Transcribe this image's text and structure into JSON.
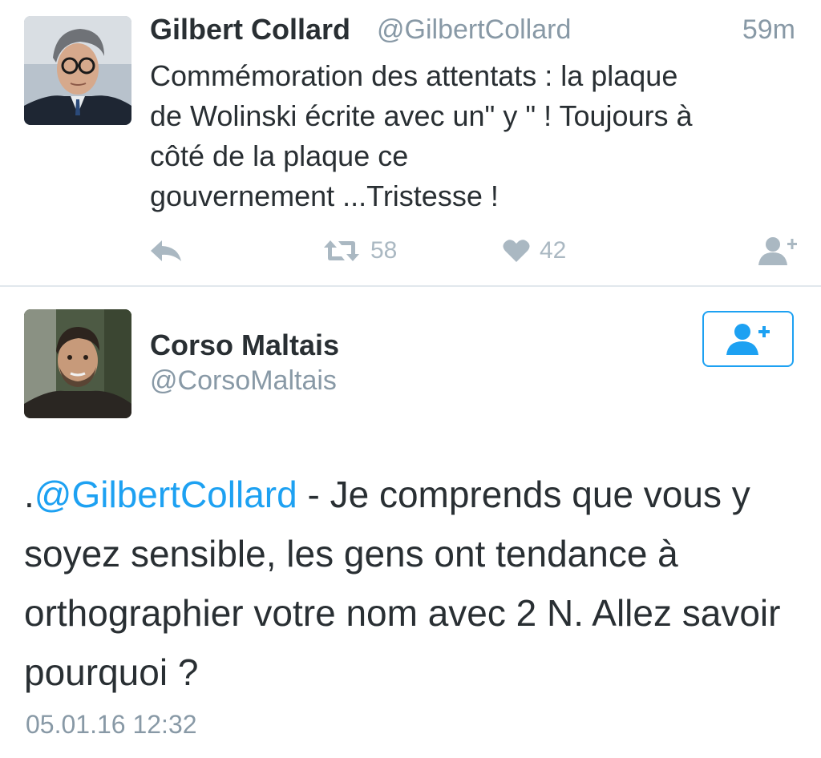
{
  "tweet1": {
    "name": "Gilbert Collard",
    "handle": "@GilbertCollard",
    "time": "59m",
    "text": "Commémoration des attentats : la plaque\nde Wolinski écrite avec un\" y \" ! Toujours à\ncôté de la plaque ce\ngouvernement ...Tristesse !",
    "avatar_icon": "profile-photo",
    "actions": {
      "reply_icon": "reply-icon",
      "retweet_icon": "retweet-icon",
      "retweet_count": "58",
      "like_icon": "heart-icon",
      "like_count": "42",
      "follow_icon": "follow-user-icon"
    }
  },
  "tweet2": {
    "name": "Corso Maltais",
    "handle": "@CorsoMaltais",
    "follow_icon": "follow-user-icon",
    "text_prefix": ".",
    "mention": "@GilbertCollard",
    "text_body": " - Je comprends que vous y soyez sensible, les gens ont tendance à orthographier votre nom avec 2 N. Allez savoir pourquoi ?",
    "date": "05.01.16 12:32"
  },
  "colors": {
    "text": "#292f33",
    "secondary": "#8899a6",
    "action": "#aab8c2",
    "accent": "#1da1f2",
    "divider": "#e1e8ed"
  }
}
